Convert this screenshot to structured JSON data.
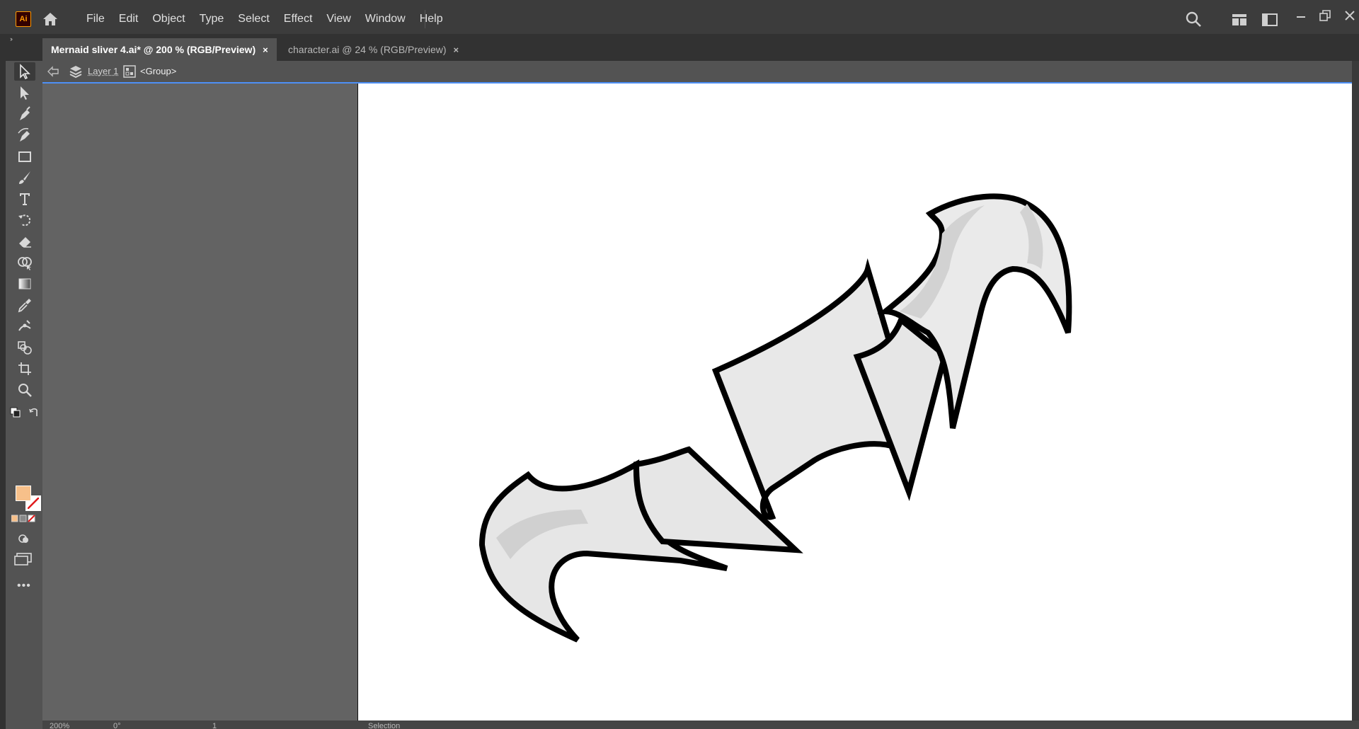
{
  "app": {
    "logo_text": "Ai",
    "accent": "#ff9a00"
  },
  "menu": [
    "File",
    "Edit",
    "Object",
    "Type",
    "Select",
    "Effect",
    "View",
    "Window",
    "Help"
  ],
  "tabs": [
    {
      "label": "Mernaid sliver 4.ai* @ 200 % (RGB/Preview)",
      "close": "×",
      "active": true
    },
    {
      "label": "character.ai @ 24 % (RGB/Preview)",
      "close": "×",
      "active": false
    }
  ],
  "breadcrumb": {
    "layer": "Layer 1",
    "group": "<Group>"
  },
  "colors": {
    "fill": "#f7c08a",
    "selection_line": "#4d8ff5",
    "artboard": "#ffffff",
    "pasteboard": "#636363"
  },
  "status": {
    "zoom": "200%",
    "rotation": "0°",
    "page": "1",
    "tool": "Selection"
  },
  "toolbar": {
    "tools": [
      "selection-tool-icon",
      "direct-selection-tool-icon",
      "pen-tool-icon",
      "curvature-tool-icon",
      "rectangle-tool-icon",
      "paintbrush-tool-icon",
      "type-tool-icon",
      "rotate-tool-icon",
      "eraser-tool-icon",
      "shape-builder-tool-icon",
      "gradient-tool-icon",
      "eyedropper-tool-icon",
      "puppet-warp-tool-icon",
      "blend-tool-icon",
      "artboard-tool-icon",
      "zoom-tool-icon"
    ],
    "more": "•••"
  }
}
